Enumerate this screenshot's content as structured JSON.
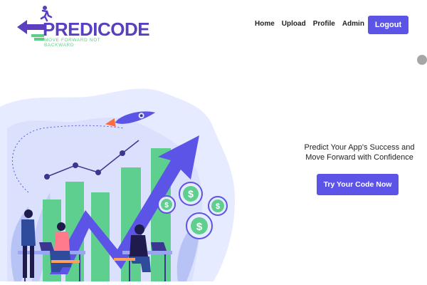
{
  "brand": {
    "name": "PREDICODE",
    "tagline": "MOVE FORWARD NOT BACKWARD"
  },
  "nav": {
    "items": [
      {
        "label": "Home"
      },
      {
        "label": "Upload"
      },
      {
        "label": "Profile"
      },
      {
        "label": "Admin"
      }
    ],
    "logout_label": "Logout"
  },
  "hero": {
    "headline": "Predict Your App's Success and Move Forward with Confidence",
    "cta_label": "Try Your Code Now"
  },
  "colors": {
    "accent": "#5b54e6",
    "brand_purple": "#5a3fc0",
    "brand_green": "#5bcf87",
    "bar_green": "#5fcf8f",
    "bg_blob": "#e6ebff"
  },
  "icons": [
    "runner-logo-icon",
    "back-arrow-logo-icon",
    "rocket-icon",
    "dollar-coin-icon"
  ]
}
